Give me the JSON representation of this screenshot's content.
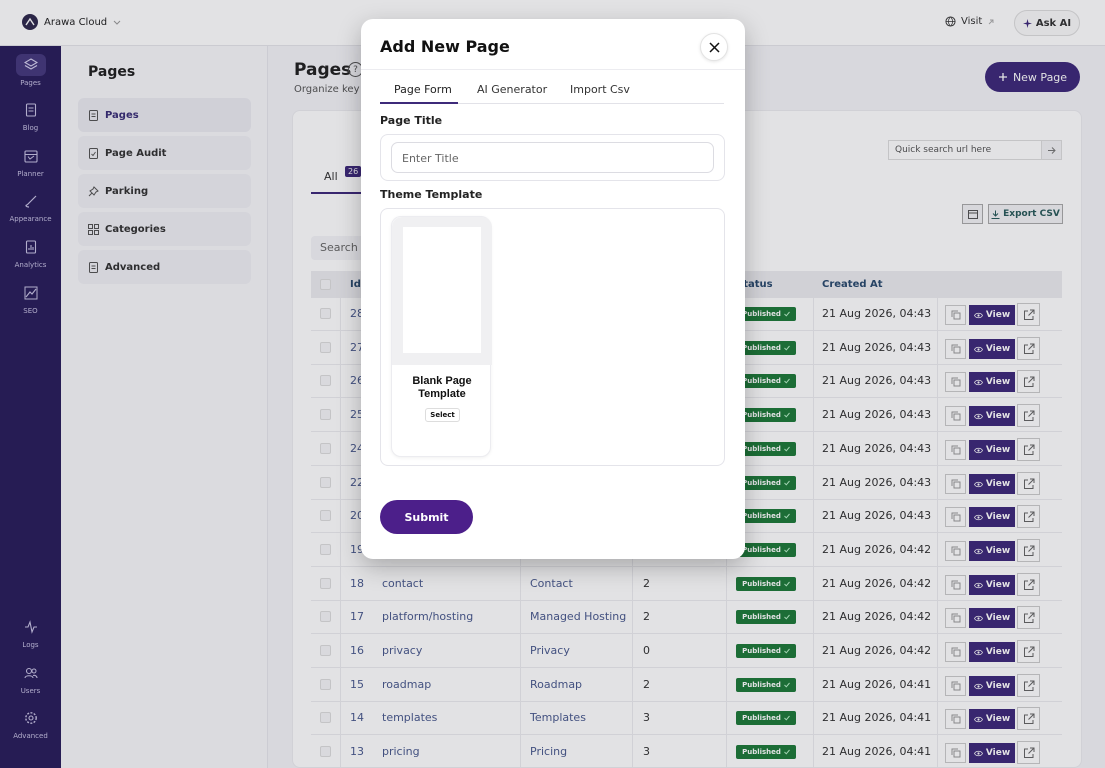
{
  "app": {
    "name": "Arawa Cloud",
    "visit_label": "Visit",
    "ask_ai_label": "Ask AI"
  },
  "rail": [
    {
      "label": "Pages",
      "icon": "layers-icon"
    },
    {
      "label": "Blog",
      "icon": "document-icon"
    },
    {
      "label": "Planner",
      "icon": "calendar-icon"
    },
    {
      "label": "Appearance",
      "icon": "brush-icon"
    },
    {
      "label": "Analytics",
      "icon": "analytics-icon"
    },
    {
      "label": "SEO",
      "icon": "trend-icon"
    },
    {
      "label": "Logs",
      "icon": "pulse-icon"
    },
    {
      "label": "Users",
      "icon": "users-icon"
    },
    {
      "label": "Advanced",
      "icon": "gear-icon"
    }
  ],
  "sidebar": {
    "title": "Pages",
    "items": [
      {
        "label": "Pages",
        "icon": "page-icon"
      },
      {
        "label": "Page Audit",
        "icon": "audit-icon"
      },
      {
        "label": "Parking",
        "icon": "pin-icon"
      },
      {
        "label": "Categories",
        "icon": "grid-icon"
      },
      {
        "label": "Advanced",
        "icon": "page-icon"
      }
    ]
  },
  "main": {
    "title": "Pages",
    "help": "?",
    "subtitle": "Organize key s",
    "new_page_label": "New Page",
    "tab_all": "All",
    "tab_all_count": "26",
    "quick_search_placeholder": "Quick search url here",
    "export_label": "Export CSV",
    "search_placeholder": "Search"
  },
  "table": {
    "headers": {
      "id": "Id",
      "status": "Status",
      "created": "Created At"
    },
    "view_label": "View",
    "rows": [
      {
        "id": "28",
        "url": "",
        "title": "",
        "count": "",
        "status": "Published",
        "created": "21 Aug 2026, 04:43"
      },
      {
        "id": "27",
        "url": "",
        "title": "",
        "count": "",
        "status": "Published",
        "created": "21 Aug 2026, 04:43"
      },
      {
        "id": "26",
        "url": "",
        "title": "",
        "count": "",
        "status": "Published",
        "created": "21 Aug 2026, 04:43"
      },
      {
        "id": "25",
        "url": "",
        "title": "",
        "count": "",
        "status": "Published",
        "created": "21 Aug 2026, 04:43"
      },
      {
        "id": "24",
        "url": "",
        "title": "",
        "count": "",
        "status": "Published",
        "created": "21 Aug 2026, 04:43"
      },
      {
        "id": "22",
        "url": "",
        "title": "",
        "count": "",
        "status": "Published",
        "created": "21 Aug 2026, 04:43"
      },
      {
        "id": "20",
        "url": "",
        "title": "",
        "count": "",
        "status": "Published",
        "created": "21 Aug 2026, 04:43"
      },
      {
        "id": "19",
        "url": "",
        "title": "",
        "count": "",
        "status": "Published",
        "created": "21 Aug 2026, 04:42"
      },
      {
        "id": "18",
        "url": "contact",
        "title": "Contact",
        "count": "2",
        "status": "Published",
        "created": "21 Aug 2026, 04:42"
      },
      {
        "id": "17",
        "url": "platform/hosting",
        "title": "Managed Hosting",
        "count": "2",
        "status": "Published",
        "created": "21 Aug 2026, 04:42"
      },
      {
        "id": "16",
        "url": "privacy",
        "title": "Privacy",
        "count": "0",
        "status": "Published",
        "created": "21 Aug 2026, 04:42"
      },
      {
        "id": "15",
        "url": "roadmap",
        "title": "Roadmap",
        "count": "2",
        "status": "Published",
        "created": "21 Aug 2026, 04:41"
      },
      {
        "id": "14",
        "url": "templates",
        "title": "Templates",
        "count": "3",
        "status": "Published",
        "created": "21 Aug 2026, 04:41"
      },
      {
        "id": "13",
        "url": "pricing",
        "title": "Pricing",
        "count": "3",
        "status": "Published",
        "created": "21 Aug 2026, 04:41"
      }
    ]
  },
  "modal": {
    "title": "Add New Page",
    "tabs": [
      "Page Form",
      "AI Generator",
      "Import Csv"
    ],
    "page_title_label": "Page Title",
    "page_title_placeholder": "Enter Title",
    "theme_template_label": "Theme Template",
    "template_name": "Blank Page Template",
    "template_select": "Select",
    "submit_label": "Submit"
  },
  "colors": {
    "primary": "#3e2a7a",
    "rail_bg": "#2a1e5c",
    "published": "#1e7a3a",
    "submit": "#4c1f8a"
  }
}
